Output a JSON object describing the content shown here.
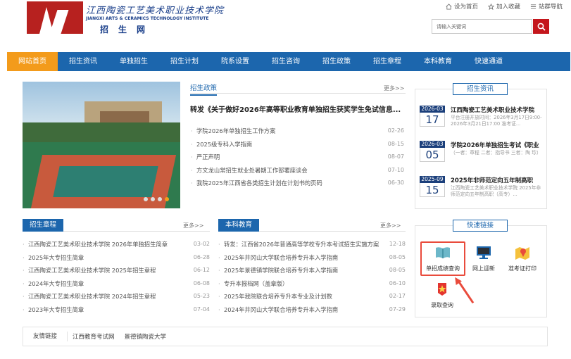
{
  "header": {
    "school_cn": "江西陶瓷工艺美术职业技术学院",
    "school_en": "JIANGXI ARTS & CERAMICS TECHNOLOGY INSTITUTE",
    "sub_title": "招生网",
    "top_links": [
      "设为首页",
      "加入收藏",
      "站群导航"
    ],
    "search_placeholder": "请输入关键词"
  },
  "nav": [
    "网站首页",
    "招生资讯",
    "单独招生",
    "招生计划",
    "院系设置",
    "招生咨询",
    "招生政策",
    "招生章程",
    "本科教育",
    "快速通道"
  ],
  "policy": {
    "tab": "招生政策",
    "more": "更多>>",
    "headline": "转发《关于做好2026年高等职业教育单独招生获奖学生免试信息...",
    "items": [
      {
        "title": "学院2026年单独招生工作方案",
        "date": "02-26"
      },
      {
        "title": "2025级专科入学指南",
        "date": "08-15"
      },
      {
        "title": "严正声明",
        "date": "08-07"
      },
      {
        "title": "方文龙山常招生就业处暑期工作部署座谈会",
        "date": "07-10"
      },
      {
        "title": "我院2025年江西省各类招生计划在计划书的页码",
        "date": "06-30"
      }
    ]
  },
  "info": {
    "title": "招生资讯",
    "items": [
      {
        "ym": "2026-03",
        "day": "17",
        "title": "江西陶瓷工艺美术职业技术学院",
        "desc": "平台注册开放时间：2026年3月17日9:00-2026年3月21日17:00 准考证..."
      },
      {
        "ym": "2026-03",
        "day": "05",
        "title": "学院2026年单独招生考试《职业",
        "desc": "（一者：章程 二者：指导书 三者：陶 珍）"
      },
      {
        "ym": "2025-09",
        "day": "15",
        "title": "2025年非师范定向五年制高职",
        "desc": "江西陶瓷工艺美术职业技术学院 2025年非师范定向五年制高职（高专）..."
      }
    ]
  },
  "charter": {
    "title": "招生章程",
    "more": "更多>>",
    "items": [
      {
        "title": "江西陶瓷工艺美术职业技术学院 2026年单独招生简章",
        "date": "03-02"
      },
      {
        "title": "2025年大专招生简章",
        "date": "06-28"
      },
      {
        "title": "江西陶瓷工艺美术职业技术学院 2025年招生章程",
        "date": "06-12"
      },
      {
        "title": "2024年大专招生简章",
        "date": "06-08"
      },
      {
        "title": "江西陶瓷工艺美术职业技术学院 2024年招生章程",
        "date": "05-23"
      },
      {
        "title": "2023年大专招生简章",
        "date": "07-04"
      }
    ]
  },
  "undergrad": {
    "title": "本科教育",
    "more": "更多>>",
    "items": [
      {
        "title": "转发：江西省2026年普通高等学校专升本考试招生实施方案",
        "date": "12-18"
      },
      {
        "title": "2025年井冈山大学联合培养专升本入学指南",
        "date": "08-05"
      },
      {
        "title": "2025年景德镇学院联合培养专升本入学指南",
        "date": "08-05"
      },
      {
        "title": "专升本报档网（盖章版）",
        "date": "06-10"
      },
      {
        "title": "2025年我院联合培养专升本专业及计划数",
        "date": "02-17"
      },
      {
        "title": "2024年井冈山大学联合培养专升本入学指南",
        "date": "07-29"
      }
    ]
  },
  "quick": {
    "title": "快速链接",
    "items": [
      {
        "label": "单招成绩查询",
        "icon": "book-icon"
      },
      {
        "label": "网上迎新",
        "icon": "monitor-icon"
      },
      {
        "label": "准考证打印",
        "icon": "map-pin-icon"
      },
      {
        "label": "录取查询",
        "icon": "star-badge-icon"
      }
    ]
  },
  "friends": {
    "label": "友情链接",
    "links": [
      "江西教育考试网",
      "景德镇陶瓷大学"
    ]
  },
  "colors": {
    "nav": "#1c66ad",
    "active": "#f39b1b",
    "brand": "#b7211f",
    "search": "#c4161c"
  }
}
